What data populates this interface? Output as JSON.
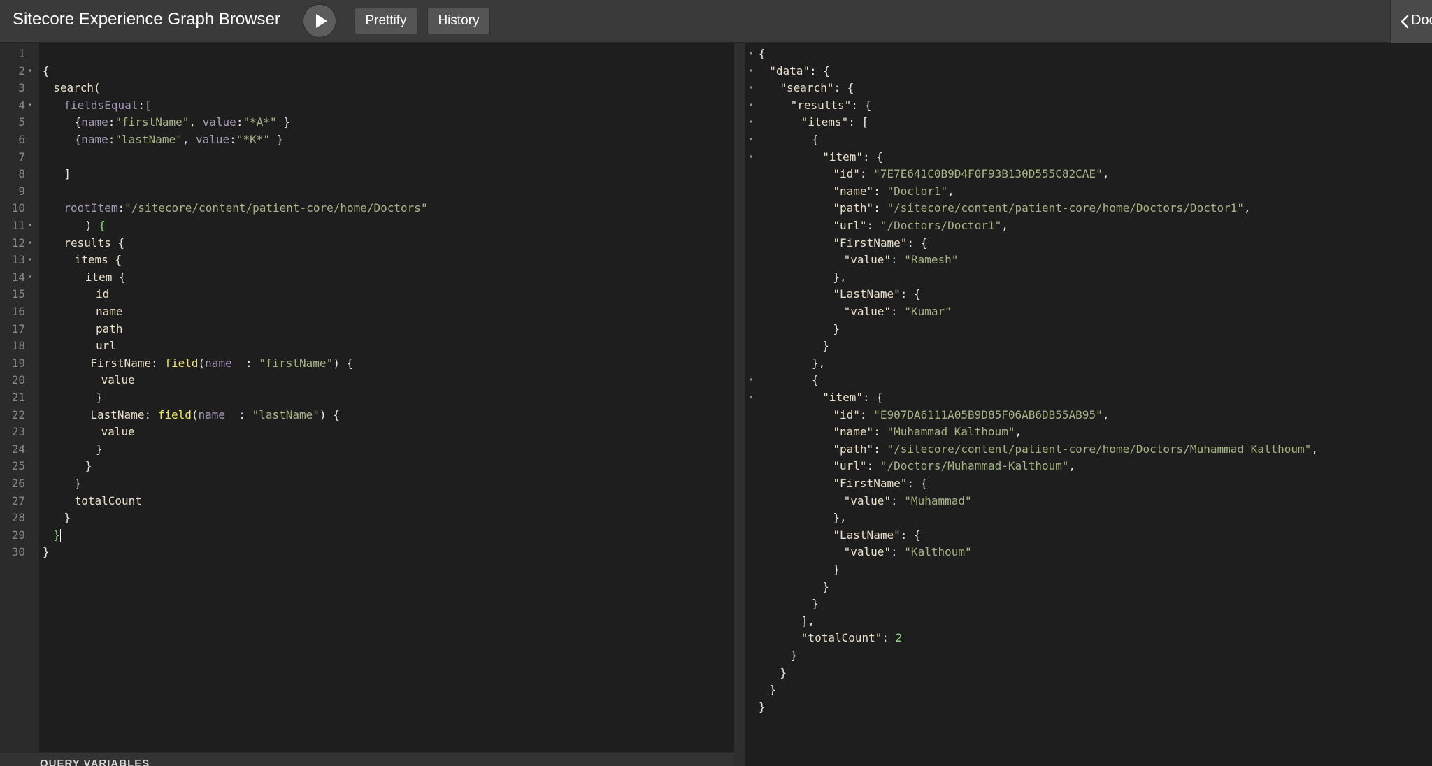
{
  "header": {
    "title": "Sitecore Experience Graph Browser",
    "run_icon": "play-icon",
    "prettify_label": "Prettify",
    "history_label": "History",
    "docs_label": "Docs",
    "docs_icon": "chevron-left-icon"
  },
  "query_editor": {
    "lines": [
      {
        "n": "1",
        "fold": false,
        "indent": 0,
        "tokens": []
      },
      {
        "n": "2",
        "fold": true,
        "indent": 0,
        "tokens": [
          [
            "{",
            "plain"
          ]
        ]
      },
      {
        "n": "3",
        "fold": false,
        "indent": 2,
        "tokens": [
          [
            "search(",
            "field"
          ]
        ]
      },
      {
        "n": "4",
        "fold": true,
        "indent": 4,
        "tokens": [
          [
            "fieldsEqual",
            "arg"
          ],
          [
            ":[",
            "plain"
          ]
        ]
      },
      {
        "n": "5",
        "fold": false,
        "indent": 6,
        "tokens": [
          [
            "{",
            "plain"
          ],
          [
            "name",
            "arg"
          ],
          [
            ":",
            "plain"
          ],
          [
            "\"firstName\"",
            "str"
          ],
          [
            ", ",
            "plain"
          ],
          [
            "value",
            "arg"
          ],
          [
            ":",
            "plain"
          ],
          [
            "\"*A*\"",
            "str"
          ],
          [
            " }",
            "plain"
          ]
        ]
      },
      {
        "n": "6",
        "fold": false,
        "indent": 6,
        "tokens": [
          [
            "{",
            "plain"
          ],
          [
            "name",
            "arg"
          ],
          [
            ":",
            "plain"
          ],
          [
            "\"lastName\"",
            "str"
          ],
          [
            ", ",
            "plain"
          ],
          [
            "value",
            "arg"
          ],
          [
            ":",
            "plain"
          ],
          [
            "\"*K*\"",
            "str"
          ],
          [
            " }",
            "plain"
          ]
        ]
      },
      {
        "n": "7",
        "fold": false,
        "indent": 0,
        "tokens": []
      },
      {
        "n": "8",
        "fold": false,
        "indent": 4,
        "tokens": [
          [
            "]",
            "plain"
          ]
        ]
      },
      {
        "n": "9",
        "fold": false,
        "indent": 0,
        "tokens": []
      },
      {
        "n": "10",
        "fold": false,
        "indent": 4,
        "tokens": [
          [
            "rootItem",
            "arg"
          ],
          [
            ":",
            "plain"
          ],
          [
            "\"/sitecore/content/patient-core/home/Doctors\"",
            "str"
          ]
        ]
      },
      {
        "n": "11",
        "fold": true,
        "indent": 8,
        "tokens": [
          [
            ") ",
            "plain"
          ],
          [
            "{",
            "green"
          ]
        ]
      },
      {
        "n": "12",
        "fold": true,
        "indent": 4,
        "tokens": [
          [
            "results {",
            "field"
          ]
        ]
      },
      {
        "n": "13",
        "fold": true,
        "indent": 6,
        "tokens": [
          [
            "items {",
            "field"
          ]
        ]
      },
      {
        "n": "14",
        "fold": true,
        "indent": 8,
        "tokens": [
          [
            "item {",
            "field"
          ]
        ]
      },
      {
        "n": "15",
        "fold": false,
        "indent": 10,
        "tokens": [
          [
            "id",
            "field"
          ]
        ]
      },
      {
        "n": "16",
        "fold": false,
        "indent": 10,
        "tokens": [
          [
            "name",
            "field"
          ]
        ]
      },
      {
        "n": "17",
        "fold": false,
        "indent": 10,
        "tokens": [
          [
            "path",
            "field"
          ]
        ]
      },
      {
        "n": "18",
        "fold": false,
        "indent": 10,
        "tokens": [
          [
            "url",
            "field"
          ]
        ]
      },
      {
        "n": "19",
        "fold": false,
        "indent": 9,
        "tokens": [
          [
            "FirstName",
            "field"
          ],
          [
            ": ",
            "plain"
          ],
          [
            "field",
            "fn"
          ],
          [
            "(",
            "plain"
          ],
          [
            "name",
            "arg"
          ],
          [
            "  : ",
            "plain"
          ],
          [
            "\"firstName\"",
            "str"
          ],
          [
            ") {",
            "plain"
          ]
        ]
      },
      {
        "n": "20",
        "fold": false,
        "indent": 11,
        "tokens": [
          [
            "value",
            "field"
          ]
        ]
      },
      {
        "n": "21",
        "fold": false,
        "indent": 10,
        "tokens": [
          [
            "}",
            "plain"
          ]
        ]
      },
      {
        "n": "22",
        "fold": false,
        "indent": 9,
        "tokens": [
          [
            "LastName",
            "field"
          ],
          [
            ": ",
            "plain"
          ],
          [
            "field",
            "fn"
          ],
          [
            "(",
            "plain"
          ],
          [
            "name",
            "arg"
          ],
          [
            "  : ",
            "plain"
          ],
          [
            "\"lastName\"",
            "str"
          ],
          [
            ") {",
            "plain"
          ]
        ]
      },
      {
        "n": "23",
        "fold": false,
        "indent": 11,
        "tokens": [
          [
            "value",
            "field"
          ]
        ]
      },
      {
        "n": "24",
        "fold": false,
        "indent": 10,
        "tokens": [
          [
            "}",
            "plain"
          ]
        ]
      },
      {
        "n": "25",
        "fold": false,
        "indent": 8,
        "tokens": [
          [
            "}",
            "plain"
          ]
        ]
      },
      {
        "n": "26",
        "fold": false,
        "indent": 6,
        "tokens": [
          [
            "}",
            "plain"
          ]
        ]
      },
      {
        "n": "27",
        "fold": false,
        "indent": 6,
        "tokens": [
          [
            "totalCount",
            "field"
          ]
        ]
      },
      {
        "n": "28",
        "fold": false,
        "indent": 4,
        "tokens": [
          [
            "}",
            "plain"
          ]
        ]
      },
      {
        "n": "29",
        "fold": false,
        "indent": 2,
        "tokens": [
          [
            "}",
            "green"
          ]
        ],
        "cursor": true
      },
      {
        "n": "30",
        "fold": false,
        "indent": 0,
        "tokens": [
          [
            "}",
            "plain"
          ]
        ]
      }
    ]
  },
  "query_variables": {
    "label": "QUERY VARIABLES"
  },
  "result": {
    "lines": [
      {
        "fold": true,
        "indent": 0,
        "tokens": [
          [
            "{",
            "plain"
          ]
        ]
      },
      {
        "fold": true,
        "indent": 2,
        "tokens": [
          [
            "\"data\"",
            "key"
          ],
          [
            ": {",
            "plain"
          ]
        ]
      },
      {
        "fold": true,
        "indent": 4,
        "tokens": [
          [
            "\"search\"",
            "key"
          ],
          [
            ": {",
            "plain"
          ]
        ]
      },
      {
        "fold": true,
        "indent": 6,
        "tokens": [
          [
            "\"results\"",
            "key"
          ],
          [
            ": {",
            "plain"
          ]
        ]
      },
      {
        "fold": true,
        "indent": 8,
        "tokens": [
          [
            "\"items\"",
            "key"
          ],
          [
            ": [",
            "plain"
          ]
        ]
      },
      {
        "fold": true,
        "indent": 10,
        "tokens": [
          [
            "{",
            "plain"
          ]
        ]
      },
      {
        "fold": true,
        "indent": 12,
        "tokens": [
          [
            "\"item\"",
            "key"
          ],
          [
            ": {",
            "plain"
          ]
        ]
      },
      {
        "fold": false,
        "indent": 14,
        "tokens": [
          [
            "\"id\"",
            "key"
          ],
          [
            ": ",
            "plain"
          ],
          [
            "\"7E7E641C0B9D4F0F93B130D555C82CAE\"",
            "str"
          ],
          [
            ",",
            "plain"
          ]
        ]
      },
      {
        "fold": false,
        "indent": 14,
        "tokens": [
          [
            "\"name\"",
            "key"
          ],
          [
            ": ",
            "plain"
          ],
          [
            "\"Doctor1\"",
            "str"
          ],
          [
            ",",
            "plain"
          ]
        ]
      },
      {
        "fold": false,
        "indent": 14,
        "tokens": [
          [
            "\"path\"",
            "key"
          ],
          [
            ": ",
            "plain"
          ],
          [
            "\"/sitecore/content/patient-core/home/Doctors/Doctor1\"",
            "str"
          ],
          [
            ",",
            "plain"
          ]
        ]
      },
      {
        "fold": false,
        "indent": 14,
        "tokens": [
          [
            "\"url\"",
            "key"
          ],
          [
            ": ",
            "plain"
          ],
          [
            "\"/Doctors/Doctor1\"",
            "str"
          ],
          [
            ",",
            "plain"
          ]
        ]
      },
      {
        "fold": false,
        "indent": 14,
        "tokens": [
          [
            "\"FirstName\"",
            "key"
          ],
          [
            ": {",
            "plain"
          ]
        ]
      },
      {
        "fold": false,
        "indent": 16,
        "tokens": [
          [
            "\"value\"",
            "key"
          ],
          [
            ": ",
            "plain"
          ],
          [
            "\"Ramesh\"",
            "str"
          ]
        ]
      },
      {
        "fold": false,
        "indent": 14,
        "tokens": [
          [
            "},",
            "plain"
          ]
        ]
      },
      {
        "fold": false,
        "indent": 14,
        "tokens": [
          [
            "\"LastName\"",
            "key"
          ],
          [
            ": {",
            "plain"
          ]
        ]
      },
      {
        "fold": false,
        "indent": 16,
        "tokens": [
          [
            "\"value\"",
            "key"
          ],
          [
            ": ",
            "plain"
          ],
          [
            "\"Kumar\"",
            "str"
          ]
        ]
      },
      {
        "fold": false,
        "indent": 14,
        "tokens": [
          [
            "}",
            "plain"
          ]
        ]
      },
      {
        "fold": false,
        "indent": 12,
        "tokens": [
          [
            "}",
            "plain"
          ]
        ]
      },
      {
        "fold": false,
        "indent": 10,
        "tokens": [
          [
            "},",
            "plain"
          ]
        ]
      },
      {
        "fold": true,
        "indent": 10,
        "tokens": [
          [
            "{",
            "plain"
          ]
        ]
      },
      {
        "fold": true,
        "indent": 12,
        "tokens": [
          [
            "\"item\"",
            "key"
          ],
          [
            ": {",
            "plain"
          ]
        ]
      },
      {
        "fold": false,
        "indent": 14,
        "tokens": [
          [
            "\"id\"",
            "key"
          ],
          [
            ": ",
            "plain"
          ],
          [
            "\"E907DA6111A05B9D85F06AB6DB55AB95\"",
            "str"
          ],
          [
            ",",
            "plain"
          ]
        ]
      },
      {
        "fold": false,
        "indent": 14,
        "tokens": [
          [
            "\"name\"",
            "key"
          ],
          [
            ": ",
            "plain"
          ],
          [
            "\"Muhammad Kalthoum\"",
            "str"
          ],
          [
            ",",
            "plain"
          ]
        ]
      },
      {
        "fold": false,
        "indent": 14,
        "tokens": [
          [
            "\"path\"",
            "key"
          ],
          [
            ": ",
            "plain"
          ],
          [
            "\"/sitecore/content/patient-core/home/Doctors/Muhammad Kalthoum\"",
            "str"
          ],
          [
            ",",
            "plain"
          ]
        ]
      },
      {
        "fold": false,
        "indent": 14,
        "tokens": [
          [
            "\"url\"",
            "key"
          ],
          [
            ": ",
            "plain"
          ],
          [
            "\"/Doctors/Muhammad-Kalthoum\"",
            "str"
          ],
          [
            ",",
            "plain"
          ]
        ]
      },
      {
        "fold": false,
        "indent": 14,
        "tokens": [
          [
            "\"FirstName\"",
            "key"
          ],
          [
            ": {",
            "plain"
          ]
        ]
      },
      {
        "fold": false,
        "indent": 16,
        "tokens": [
          [
            "\"value\"",
            "key"
          ],
          [
            ": ",
            "plain"
          ],
          [
            "\"Muhammad\"",
            "str"
          ]
        ]
      },
      {
        "fold": false,
        "indent": 14,
        "tokens": [
          [
            "},",
            "plain"
          ]
        ]
      },
      {
        "fold": false,
        "indent": 14,
        "tokens": [
          [
            "\"LastName\"",
            "key"
          ],
          [
            ": {",
            "plain"
          ]
        ]
      },
      {
        "fold": false,
        "indent": 16,
        "tokens": [
          [
            "\"value\"",
            "key"
          ],
          [
            ": ",
            "plain"
          ],
          [
            "\"Kalthoum\"",
            "str"
          ]
        ]
      },
      {
        "fold": false,
        "indent": 14,
        "tokens": [
          [
            "}",
            "plain"
          ]
        ]
      },
      {
        "fold": false,
        "indent": 12,
        "tokens": [
          [
            "}",
            "plain"
          ]
        ]
      },
      {
        "fold": false,
        "indent": 10,
        "tokens": [
          [
            "}",
            "plain"
          ]
        ]
      },
      {
        "fold": false,
        "indent": 8,
        "tokens": [
          [
            "],",
            "plain"
          ]
        ]
      },
      {
        "fold": false,
        "indent": 8,
        "tokens": [
          [
            "\"totalCount\"",
            "key"
          ],
          [
            ": ",
            "plain"
          ],
          [
            "2",
            "num"
          ]
        ]
      },
      {
        "fold": false,
        "indent": 6,
        "tokens": [
          [
            "}",
            "plain"
          ]
        ]
      },
      {
        "fold": false,
        "indent": 4,
        "tokens": [
          [
            "}",
            "plain"
          ]
        ]
      },
      {
        "fold": false,
        "indent": 2,
        "tokens": [
          [
            "}",
            "plain"
          ]
        ]
      },
      {
        "fold": false,
        "indent": 0,
        "tokens": [
          [
            "}",
            "plain"
          ]
        ]
      }
    ]
  },
  "colors": {
    "topbar": "#3a3a3a",
    "editor_bg": "#1e1e1e",
    "string": "#a5b384",
    "argument": "#a59bb5",
    "function": "#f2e26a",
    "number": "#89d67a"
  }
}
